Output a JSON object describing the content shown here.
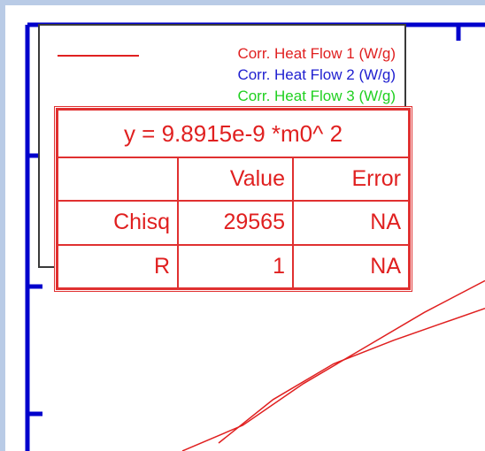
{
  "chart_data": {
    "type": "line",
    "legend": {
      "placement": "top-left",
      "entries": [
        {
          "name": "Corr. Heat Flow 1 (W/g)",
          "color": "#e02020"
        },
        {
          "name": "Corr. Heat Flow 2 (W/g)",
          "color": "#2020d0"
        },
        {
          "name": "Corr. Heat Flow 3 (W/g)",
          "color": "#20d020"
        }
      ]
    },
    "fit": {
      "equation": "y = 9.8915e-9 *m0^ 2",
      "headers": [
        "",
        "Value",
        "Error"
      ],
      "rows": [
        {
          "label": "Chisq",
          "value": "29565",
          "error": "NA"
        },
        {
          "label": "R",
          "value": "1",
          "error": "NA"
        }
      ]
    },
    "series": [
      {
        "color": "#e02020",
        "x": [
          0,
          0.2,
          0.4,
          0.6,
          0.8,
          1.0
        ],
        "y": [
          0,
          0.13,
          0.34,
          0.52,
          0.7,
          0.86
        ]
      },
      {
        "color": "#e02020",
        "x": [
          0.12,
          0.3,
          0.5,
          0.7,
          0.85,
          1.0
        ],
        "y": [
          0.04,
          0.26,
          0.44,
          0.56,
          0.64,
          0.72
        ]
      }
    ],
    "grid": false
  }
}
